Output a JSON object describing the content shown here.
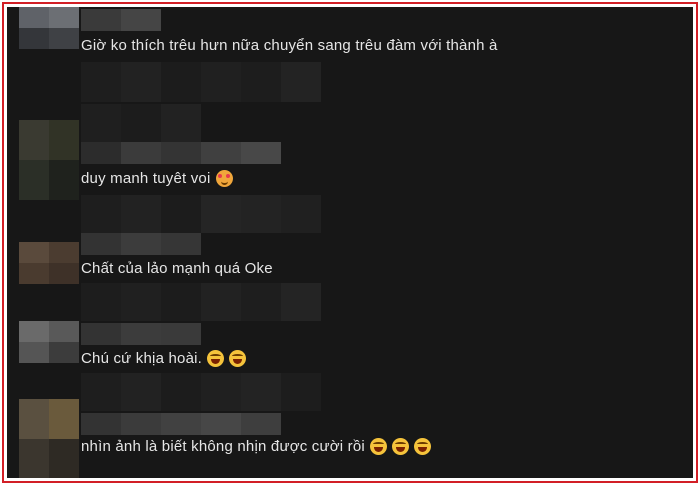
{
  "comments": [
    {
      "text": "Giờ ko thích trêu hưn nữa chuyển sang trêu đàm với thành à",
      "emojis": []
    },
    {
      "text": "duy manh tuyêt voi",
      "emojis": [
        "smiling-face-with-hearts"
      ]
    },
    {
      "text": "Chất của lảo mạnh quá Oke",
      "emojis": []
    },
    {
      "text": "Chú cứ khịa hoài.",
      "emojis": [
        "laughing-face",
        "laughing-face"
      ]
    },
    {
      "text": "nhìn ảnh là biết không nhịn được cười rồi",
      "emojis": [
        "laughing-face",
        "laughing-face",
        "laughing-face"
      ]
    }
  ],
  "colors": {
    "frame_border": "#d21f26",
    "background": "#171717",
    "text": "#e6e6e6",
    "emoji_fill": "#f5c33b"
  }
}
